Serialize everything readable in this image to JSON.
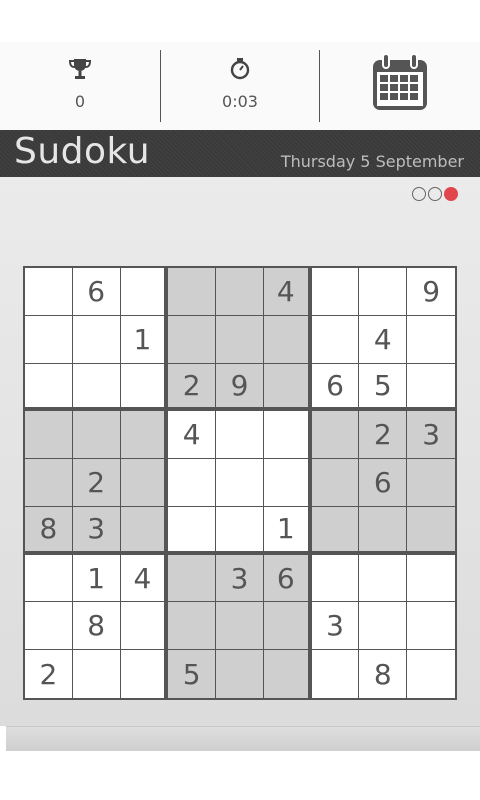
{
  "stats": {
    "best_icon": "trophy-icon",
    "best_value": "0",
    "timer_icon": "stopwatch-icon",
    "timer_value": "0:03",
    "calendar_icon": "calendar-icon"
  },
  "header": {
    "title": "Sudoku",
    "date": "Thursday 5 September"
  },
  "difficulty": {
    "levels": 3,
    "selected": 3,
    "accent": "#e0474c"
  },
  "grid": {
    "rows": [
      [
        "",
        "6",
        "",
        "",
        "",
        "4",
        "",
        "",
        "9"
      ],
      [
        "",
        "",
        "1",
        "",
        "",
        "",
        "",
        "4",
        ""
      ],
      [
        "",
        "",
        "",
        "2",
        "9",
        "",
        "6",
        "5",
        ""
      ],
      [
        "",
        "",
        "",
        "4",
        "",
        "",
        "",
        "2",
        "3"
      ],
      [
        "",
        "2",
        "",
        "",
        "",
        "",
        "",
        "6",
        ""
      ],
      [
        "8",
        "3",
        "",
        "",
        "",
        "1",
        "",
        "",
        ""
      ],
      [
        "",
        "1",
        "4",
        "",
        "3",
        "6",
        "",
        "",
        ""
      ],
      [
        "",
        "8",
        "",
        "",
        "",
        "",
        "3",
        "",
        ""
      ],
      [
        "2",
        "",
        "",
        "5",
        "",
        "",
        "",
        "8",
        ""
      ]
    ],
    "shaded_boxes": [
      1,
      3,
      5,
      7
    ],
    "shade_color": "#cfcfcf",
    "line_color": "#555555"
  }
}
